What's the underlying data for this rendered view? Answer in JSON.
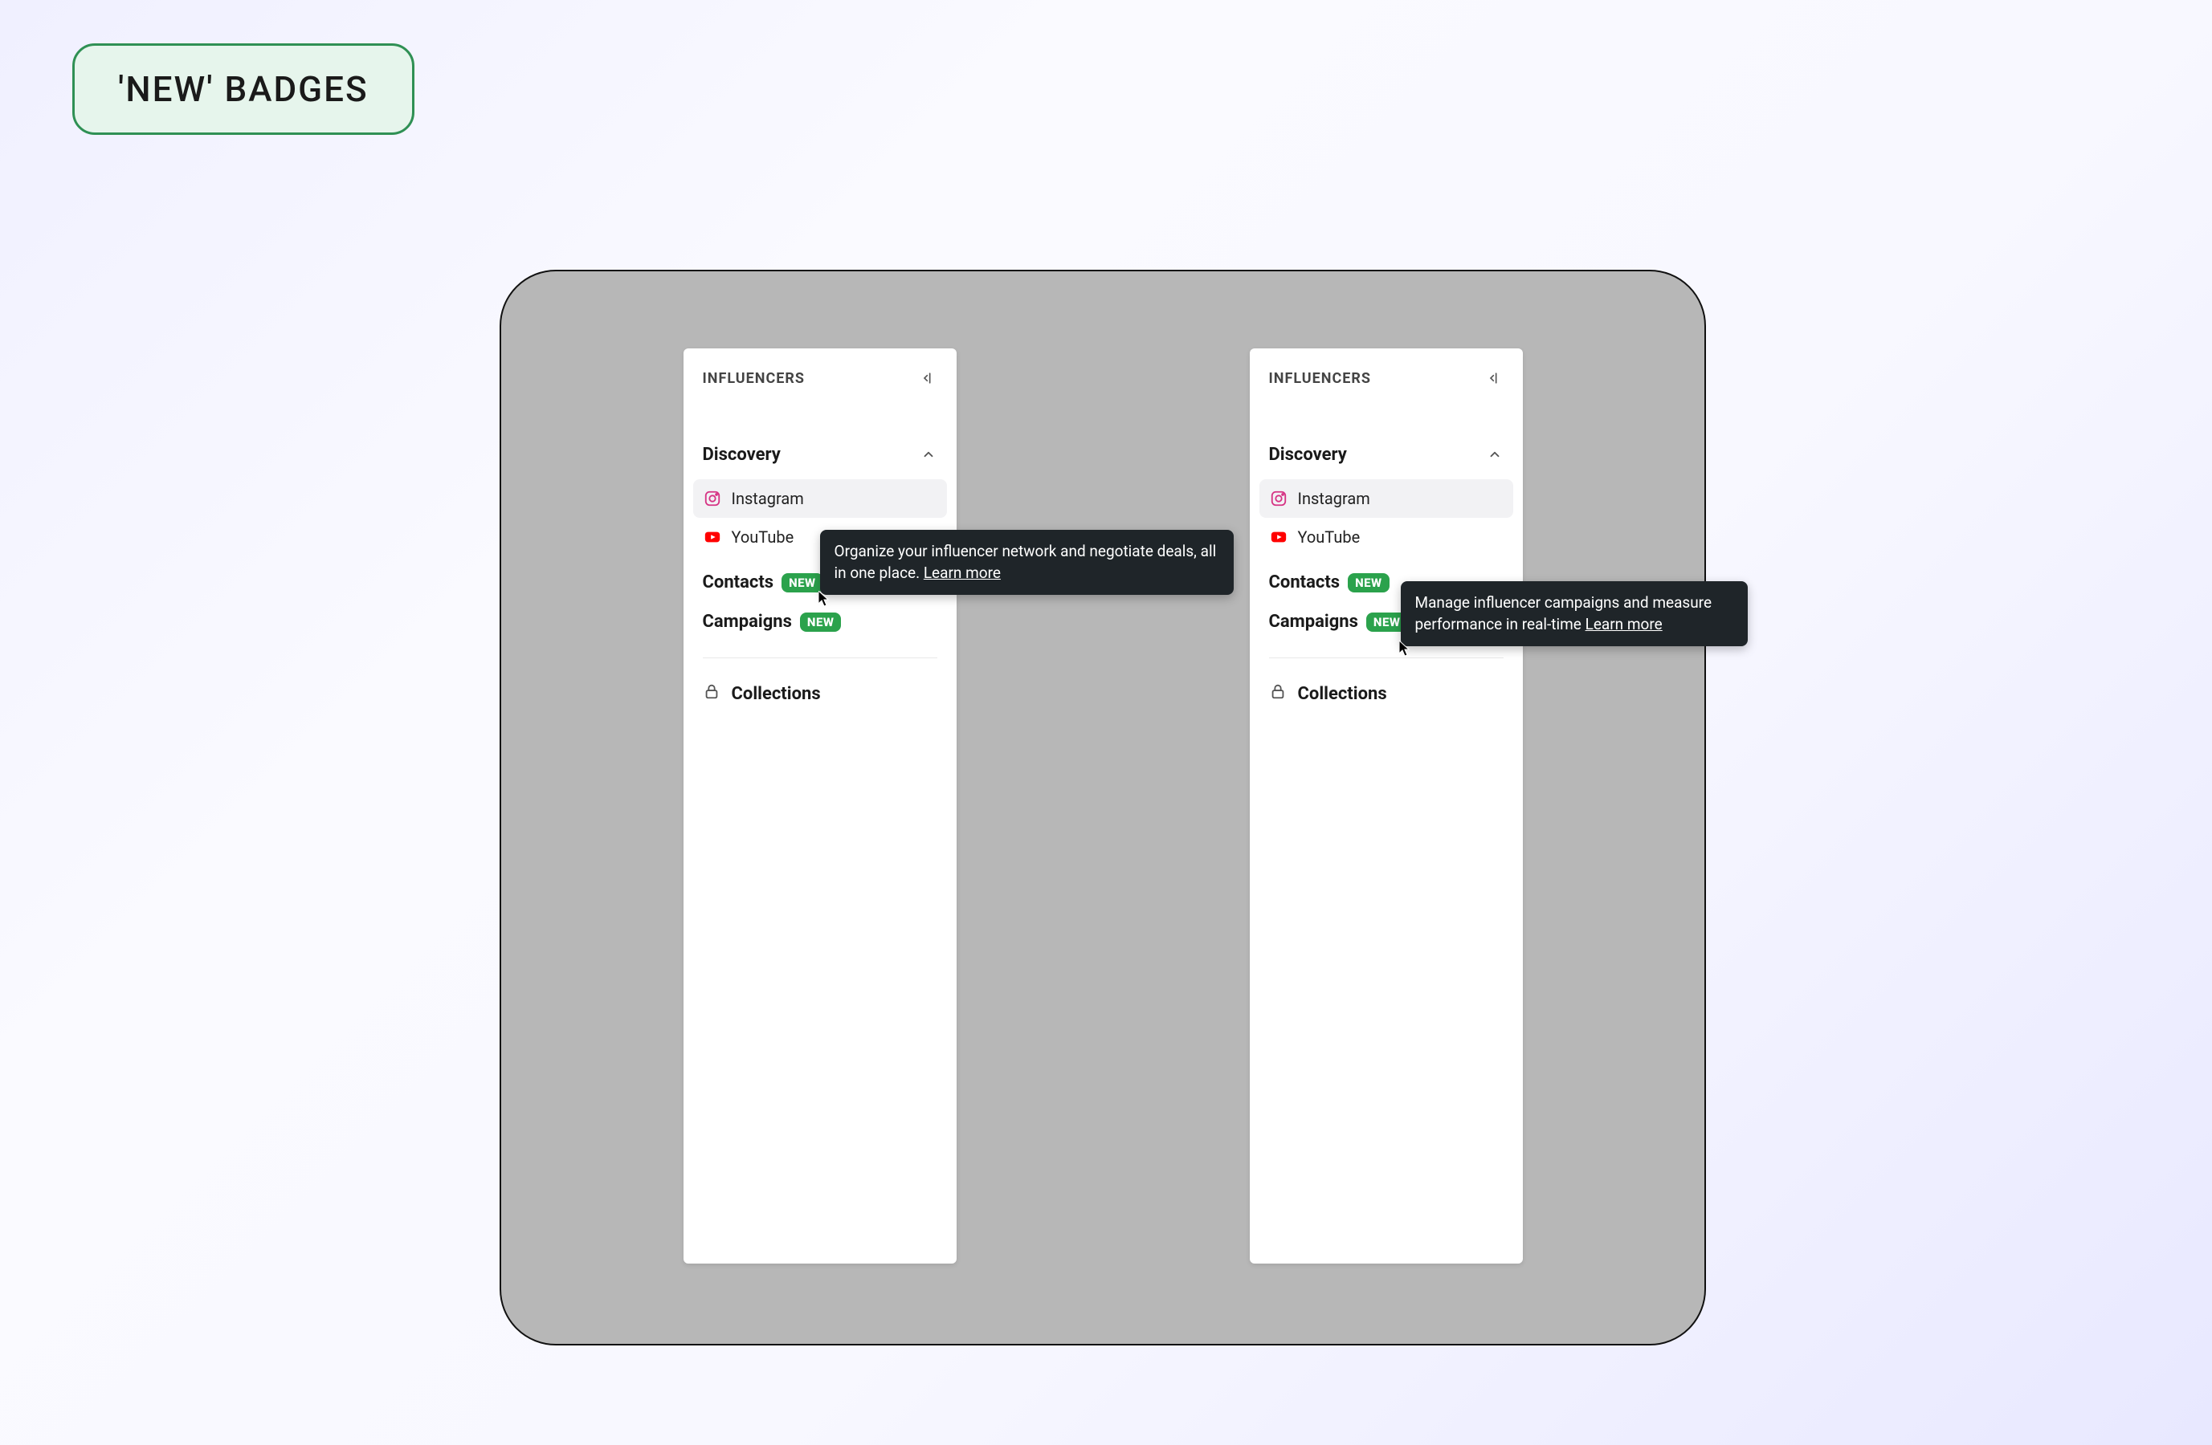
{
  "title_badge": "'NEW' BADGES",
  "sidebar": {
    "header_label": "INFLUENCERS",
    "sections": {
      "discovery": {
        "label": "Discovery",
        "items": [
          {
            "label": "Instagram"
          },
          {
            "label": "YouTube"
          }
        ]
      }
    },
    "features": {
      "contacts": {
        "label": "Contacts",
        "badge": "NEW"
      },
      "campaigns": {
        "label": "Campaigns",
        "badge": "NEW"
      }
    },
    "collections_label": "Collections"
  },
  "tooltips": {
    "contacts": {
      "text": "Organize your influencer network and negotiate deals, all in one place. ",
      "learn_more": "Learn more"
    },
    "campaigns": {
      "text": "Manage influencer campaigns and measure performance in real-time ",
      "learn_more": "Learn more"
    }
  }
}
